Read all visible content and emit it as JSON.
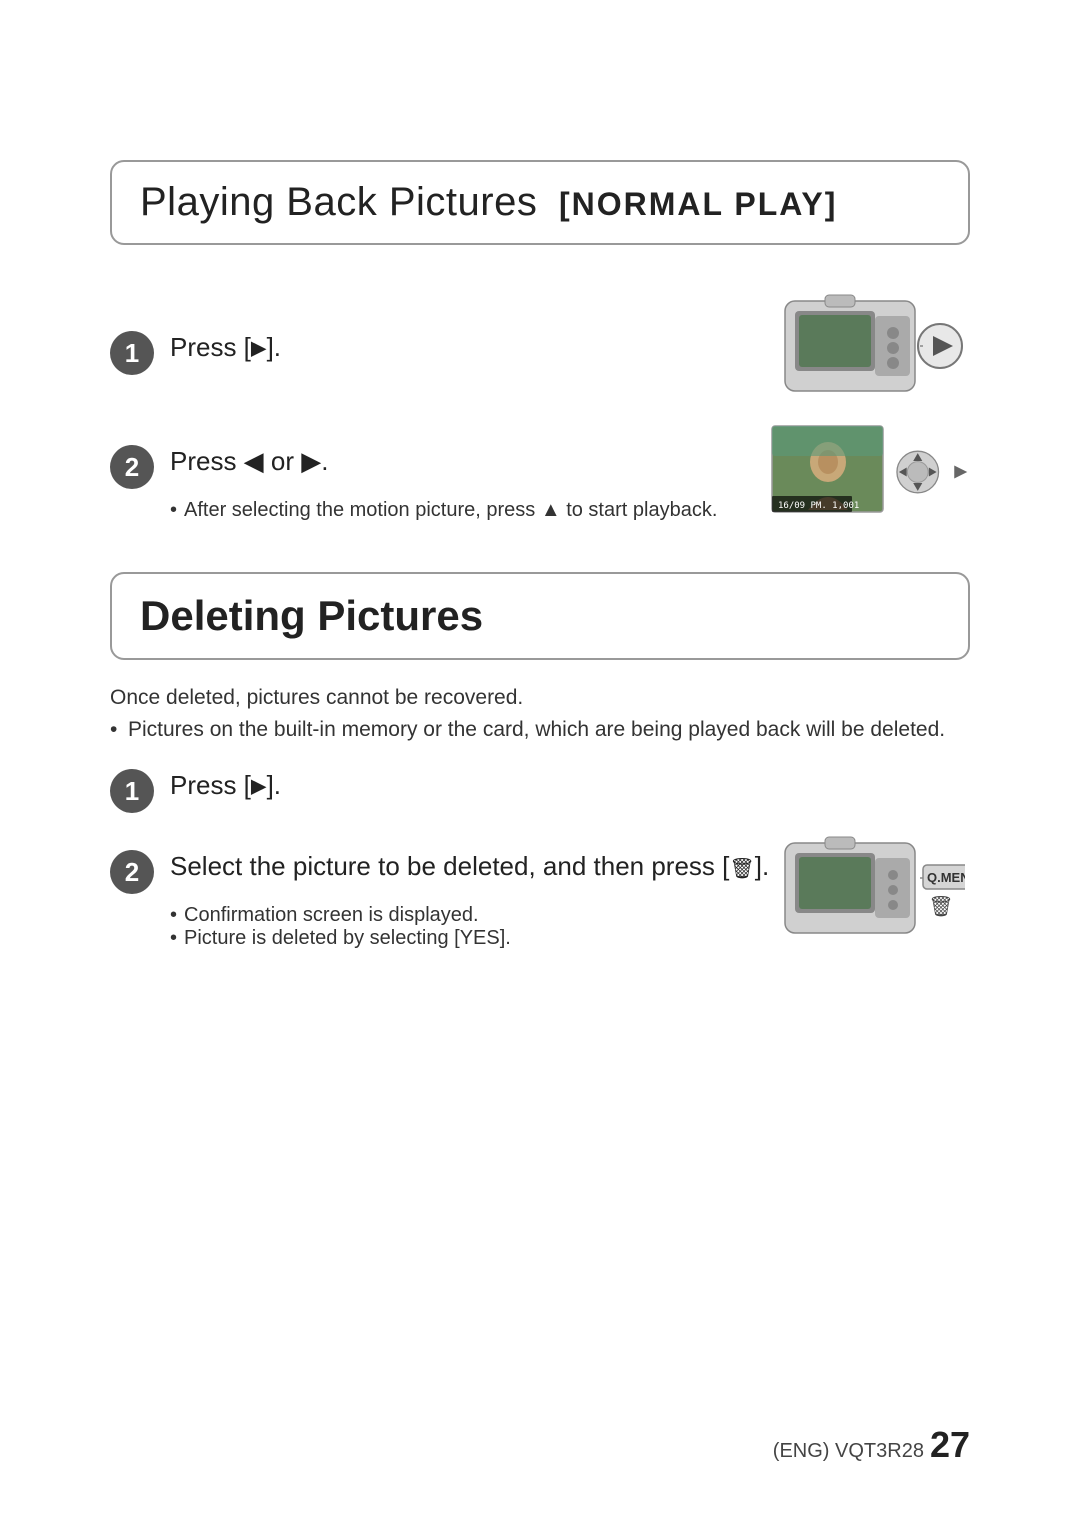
{
  "page": {
    "background": "#ffffff"
  },
  "playing_back": {
    "section_title": "Playing Back Pictures",
    "section_subtitle": "[NORMAL PLAY]",
    "step1": {
      "number": "1",
      "text": "Press [",
      "button": "▶",
      "text_end": "]."
    },
    "step2": {
      "number": "2",
      "text": "Press ◀ or ▶.",
      "sub_bullet": "After selecting the motion picture, press ▲ to start playback."
    }
  },
  "deleting": {
    "section_title": "Deleting Pictures",
    "note1": "Once deleted, pictures cannot be recovered.",
    "note2": "Pictures on the built-in memory or the card, which are being played back will be deleted.",
    "step1": {
      "number": "1",
      "text": "Press [",
      "button": "▶",
      "text_end": "]."
    },
    "step2": {
      "number": "2",
      "text": "Select the picture to be deleted, and then press [",
      "button": "🗑",
      "text_end": "].",
      "sub1": "Confirmation screen is displayed.",
      "sub2": "Picture is deleted by selecting [YES]."
    }
  },
  "footer": {
    "label": "(ENG) VQT3R28",
    "page_number": "27"
  }
}
